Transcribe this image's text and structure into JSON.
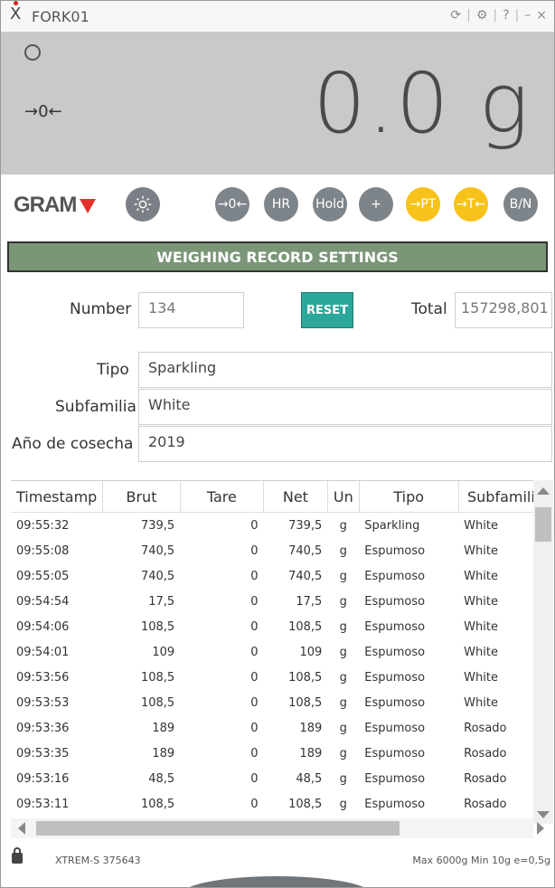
{
  "window": {
    "title": "FORK01",
    "controls": [
      "⟳",
      "⚙",
      "?",
      "–",
      "×"
    ]
  },
  "display": {
    "weight": "0.0 g",
    "zero_indicator": "→0←"
  },
  "toolbar": {
    "logo": "GRAM",
    "buttons": [
      {
        "label": "→0←",
        "color": "#7d848a"
      },
      {
        "label": "HR",
        "color": "#7d848a"
      },
      {
        "label": "Hold",
        "color": "#7d848a"
      },
      {
        "label": "+",
        "color": "#7d848a"
      },
      {
        "label": "→PT",
        "color": "#f7c21a"
      },
      {
        "label": "→T←",
        "color": "#f7c21a"
      },
      {
        "label": "B/N",
        "color": "#7d848a"
      }
    ]
  },
  "section_title": "WEIGHING RECORD SETTINGS",
  "form": {
    "number_label": "Number",
    "number_value": "134",
    "reset_label": "RESET",
    "total_label": "Total",
    "total_value": "157298,801",
    "tipo_label": "Tipo",
    "tipo_value": "Sparkling",
    "subfamilia_label": "Subfamilia",
    "subfamilia_value": "White",
    "cosecha_label": "Año de cosecha",
    "cosecha_value": "2019"
  },
  "table": {
    "headers": [
      "Timestamp",
      "Brut",
      "Tare",
      "Net",
      "Un",
      "Tipo",
      "Subfamilia"
    ],
    "rows": [
      [
        "09:55:32",
        "739,5",
        "0",
        "739,5",
        "g",
        "Sparkling",
        "White"
      ],
      [
        "09:55:08",
        "740,5",
        "0",
        "740,5",
        "g",
        "Espumoso",
        "White"
      ],
      [
        "09:55:05",
        "740,5",
        "0",
        "740,5",
        "g",
        "Espumoso",
        "White"
      ],
      [
        "09:54:54",
        "17,5",
        "0",
        "17,5",
        "g",
        "Espumoso",
        "White"
      ],
      [
        "09:54:06",
        "108,5",
        "0",
        "108,5",
        "g",
        "Espumoso",
        "White"
      ],
      [
        "09:54:01",
        "109",
        "0",
        "109",
        "g",
        "Espumoso",
        "White"
      ],
      [
        "09:53:56",
        "108,5",
        "0",
        "108,5",
        "g",
        "Espumoso",
        "White"
      ],
      [
        "09:53:53",
        "108,5",
        "0",
        "108,5",
        "g",
        "Espumoso",
        "White"
      ],
      [
        "09:53:36",
        "189",
        "0",
        "189",
        "g",
        "Espumoso",
        "Rosado"
      ],
      [
        "09:53:35",
        "189",
        "0",
        "189",
        "g",
        "Espumoso",
        "Rosado"
      ],
      [
        "09:53:16",
        "48,5",
        "0",
        "48,5",
        "g",
        "Espumoso",
        "Rosado"
      ],
      [
        "09:53:11",
        "108,5",
        "0",
        "108,5",
        "g",
        "Espumoso",
        "Rosado"
      ]
    ]
  },
  "status": {
    "device": "XTREM-S  375643",
    "spec": "Max 6000g  Min 10g  e=0,5g"
  }
}
